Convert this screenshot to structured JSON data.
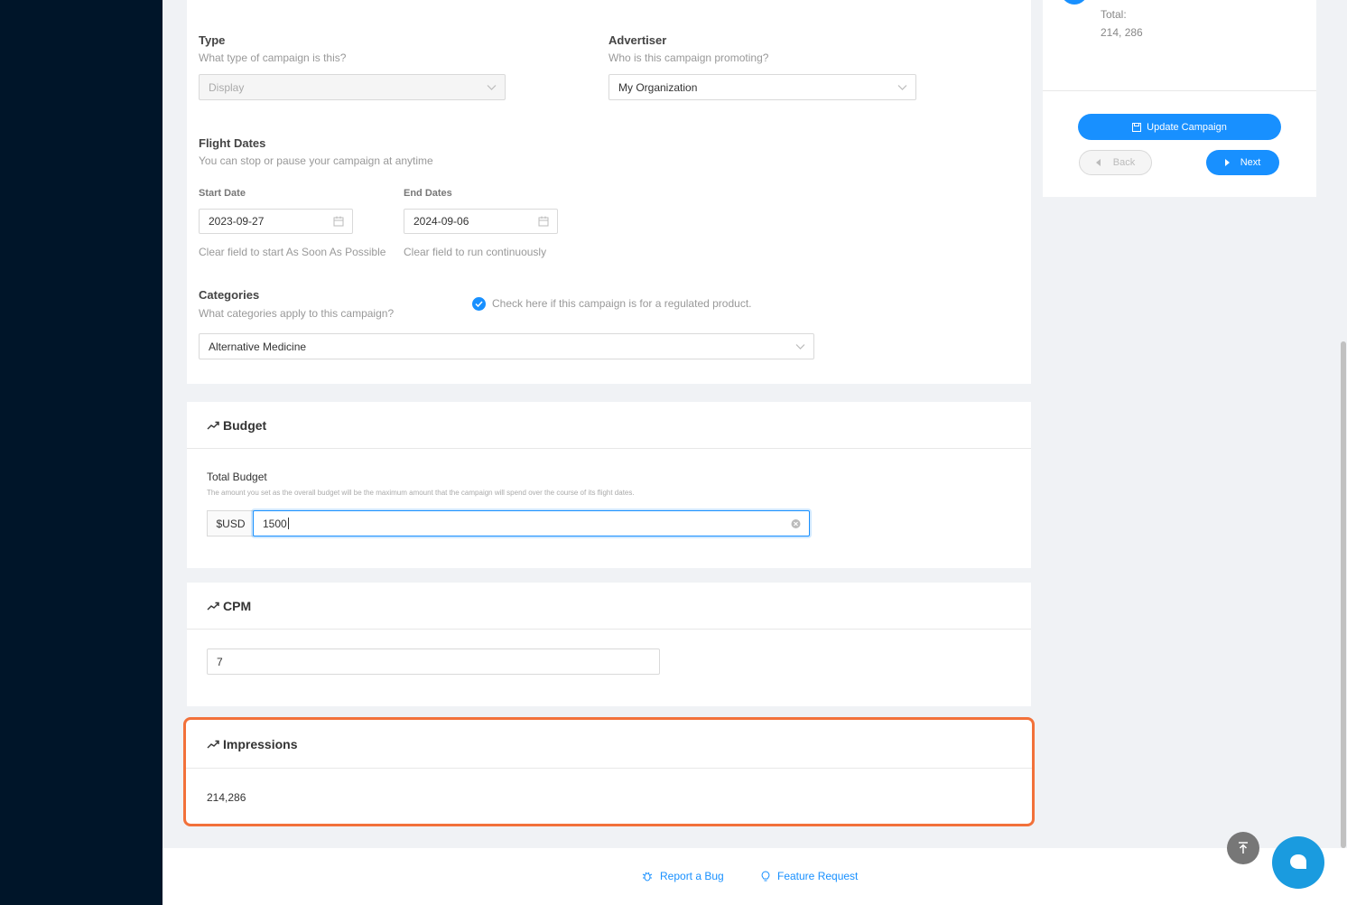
{
  "form": {
    "type_label": "Type",
    "type_help": "What type of campaign is this?",
    "type_value": "Display",
    "advertiser_label": "Advertiser",
    "advertiser_help": "Who is this campaign promoting?",
    "advertiser_value": "My Organization",
    "flight_label": "Flight Dates",
    "flight_help": "You can stop or pause your campaign at anytime",
    "start_label": "Start Date",
    "start_value": "2023-09-27",
    "start_help": "Clear field to start As Soon As Possible",
    "end_label": "End Dates",
    "end_value": "2024-09-06",
    "end_help": "Clear field to run continuously",
    "categories_label": "Categories",
    "categories_help": "What categories apply to this campaign?",
    "regulated_label": "Check here if this campaign is for a regulated product.",
    "categories_value": "Alternative Medicine"
  },
  "budget": {
    "title": "Budget",
    "total_label": "Total Budget",
    "total_help": "The amount you set as the overall budget will be the maximum amount that the campaign will spend over the course of its flight dates.",
    "currency": "$USD",
    "value": "1500"
  },
  "cpm": {
    "title": "CPM",
    "value": "7"
  },
  "impressions": {
    "title": "Impressions",
    "value": "214,286"
  },
  "summary": {
    "total_label": "Total:",
    "total_value": "214, 286",
    "update_label": "Update Campaign",
    "back_label": "Back",
    "next_label": "Next"
  },
  "footer": {
    "bug_label": "Report a Bug",
    "feature_label": "Feature Request"
  },
  "colors": {
    "primary": "#1890ff",
    "highlight": "#f2713a",
    "sidebar": "#001529"
  }
}
